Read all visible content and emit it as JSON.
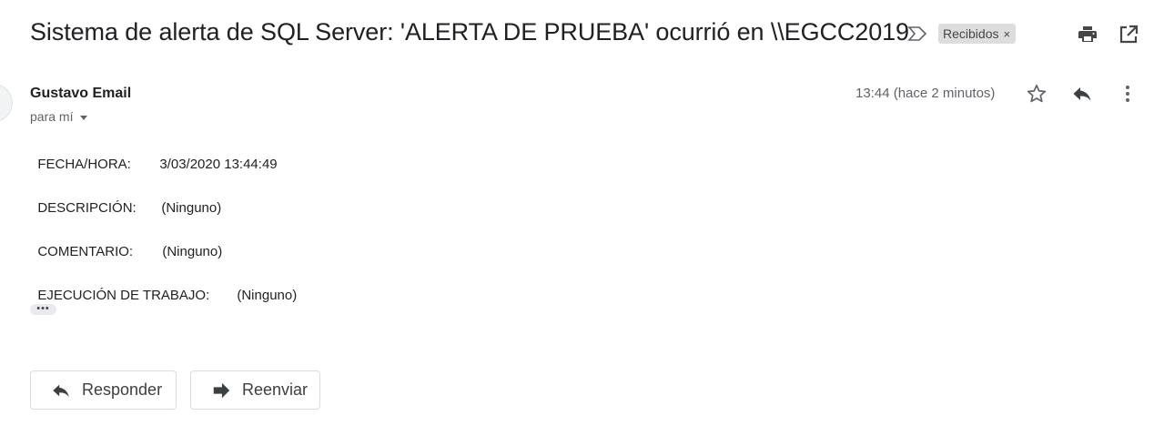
{
  "email": {
    "subject": "Sistema de alerta de SQL Server: 'ALERTA DE PRUEBA' ocurrió en \\\\EGCC2019",
    "label": "Recibidos",
    "label_close": "×",
    "sender": "Gustavo Email",
    "to": "para mí",
    "time": "13:44 (hace 2 minutos)",
    "body": [
      {
        "key": "FECHA/HORA:",
        "value": "3/03/2020 13:44:49"
      },
      {
        "key": "DESCRIPCIÓN:",
        "value": "(Ninguno)"
      },
      {
        "key": "COMENTARIO:",
        "value": "(Ninguno)"
      },
      {
        "key": "EJECUCIÓN DE TRABAJO:",
        "value": "(Ninguno)"
      }
    ],
    "ellipsis": "•••"
  },
  "actions": {
    "reply_label": "Responder",
    "forward_label": "Reenviar"
  },
  "icons": [
    "importance-marker-icon",
    "print-icon",
    "open-in-new-window-icon",
    "star-icon",
    "reply-icon",
    "more-vert-icon"
  ]
}
